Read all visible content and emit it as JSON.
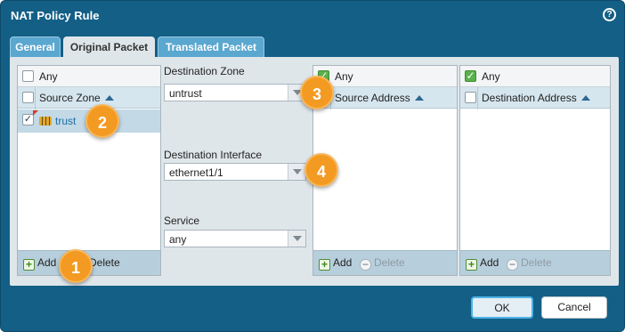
{
  "dialog": {
    "title": "NAT Policy Rule",
    "help_icon": "?"
  },
  "tabs": [
    {
      "label": "General",
      "active": false
    },
    {
      "label": "Original Packet",
      "active": true
    },
    {
      "label": "Translated Packet",
      "active": false
    }
  ],
  "source_zone": {
    "any_label": "Any",
    "any_checked": false,
    "header": "Source Zone",
    "items": [
      {
        "label": "trust",
        "checked": true
      }
    ],
    "add_label": "Add",
    "delete_label": "Delete"
  },
  "destination_zone": {
    "label": "Destination Zone",
    "value": "untrust"
  },
  "destination_interface": {
    "label": "Destination Interface",
    "value": "ethernet1/1"
  },
  "service": {
    "label": "Service",
    "value": "any"
  },
  "source_address": {
    "any_label": "Any",
    "any_checked": true,
    "header": "Source Address",
    "add_label": "Add",
    "delete_label": "Delete"
  },
  "destination_address": {
    "any_label": "Any",
    "any_checked": true,
    "header": "Destination Address",
    "add_label": "Add",
    "delete_label": "Delete"
  },
  "callouts": [
    "1",
    "2",
    "3",
    "4"
  ],
  "buttons": {
    "ok": "OK",
    "cancel": "Cancel"
  },
  "colors": {
    "dialog_bg": "#135f86",
    "tab_inactive": "#5aa7cf",
    "callout": "#f39a22",
    "check_green": "#59b14a"
  },
  "icons": {
    "help": "help-icon",
    "zone": "zone-icon",
    "add": "plus-icon",
    "delete": "minus-icon",
    "sort": "sort-ascending-icon"
  }
}
